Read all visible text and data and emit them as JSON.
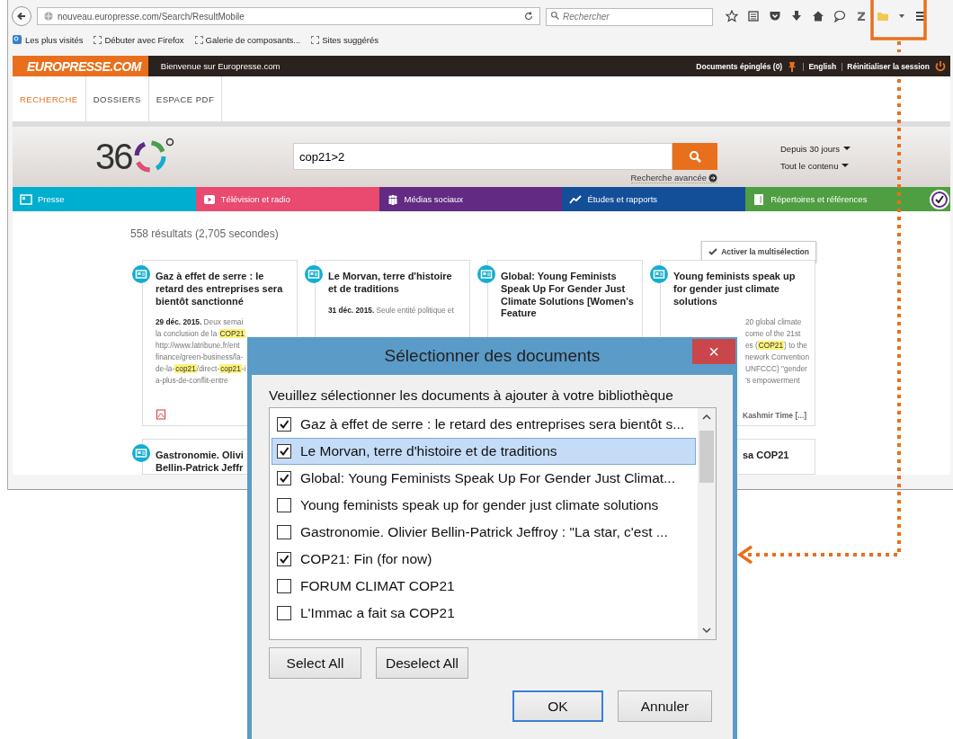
{
  "browser": {
    "url": "nouveau.europresse.com/Search/ResultMobile",
    "search_placeholder": "Rechercher",
    "bookmarks": [
      "Les plus visités",
      "Débuter avec Firefox",
      "Galerie de composants...",
      "Sites suggérés"
    ]
  },
  "site_header": {
    "logo": "EUROPRESSE.COM",
    "welcome": "Bienvenue sur Europresse.com",
    "pinned": "Documents épinglés (0)",
    "separators": [
      "|",
      "|"
    ],
    "language": "English",
    "reset": "Réinitialiser la session"
  },
  "nav_tabs": [
    {
      "label": "RECHERCHE",
      "selected": true
    },
    {
      "label": "DOSSIERS",
      "selected": false
    },
    {
      "label": "ESPACE PDF",
      "selected": false
    }
  ],
  "search": {
    "logo": "36",
    "query": "cop21>2",
    "advanced": "Recherche avancée",
    "filters": [
      "Depuis 30 jours",
      "Tout le contenu"
    ]
  },
  "categories": [
    {
      "label": "Presse",
      "color": "#00aed0"
    },
    {
      "label": "Télévision et radio",
      "color": "#e84a70"
    },
    {
      "label": "Médias sociaux",
      "color": "#622a82"
    },
    {
      "label": "Études et rapports",
      "color": "#134e98"
    },
    {
      "label": "Répertoires et références",
      "color": "#4f9e42"
    }
  ],
  "results": {
    "count": "558 résultats (2,705 secondes)",
    "multiselect": "Activer la multisélection"
  },
  "cards": [
    {
      "title": "Gaz à effet de serre : le retard des entreprises sera bientôt sanctionné",
      "lines": [
        [
          {
            "text": "**29 déc. 2015.** Deux semai",
            "highlighted": false
          }
        ],
        [
          {
            "text": "la conclusion de la ",
            "highlighted": false
          },
          {
            "text": "COP21",
            "highlighted": true
          }
        ],
        [
          {
            "text": "http://www.latribune.fr/ent",
            "highlighted": false
          }
        ],
        [
          {
            "text": "finance/green-business/la-",
            "highlighted": false
          }
        ],
        [
          {
            "text": "de-la-",
            "highlighted": false
          },
          {
            "text": "cop21",
            "highlighted": true
          },
          {
            "text": "/direct-",
            "highlighted": false
          },
          {
            "text": "cop21",
            "highlighted": true
          },
          {
            "text": "-i",
            "highlighted": false
          }
        ],
        [
          {
            "text": "a-plus-de-conflit-entre",
            "highlighted": false
          }
        ]
      ],
      "pdf": true
    },
    {
      "title": "Le Morvan, terre d'histoire et de traditions",
      "lines": [
        [
          {
            "text": "**31 déc. 2015.** Seule entité politique et",
            "highlighted": false
          }
        ]
      ],
      "pdf": false
    },
    {
      "title": "Global: Young Feminists Speak Up For Gender Just Climate Solutions [Women's Feature",
      "pdf": false
    },
    {
      "title": "Young feminists speak up for gender just climate solutions",
      "lines": [
        [
          {
            "text": "20 global climate",
            "highlighted": false
          }
        ],
        [
          {
            "text": "come of the 21st",
            "highlighted": false
          }
        ],
        [
          {
            "text": "es (",
            "highlighted": false
          },
          {
            "text": "COP21",
            "highlighted": true
          },
          {
            "text": ") to the",
            "highlighted": false
          }
        ],
        [
          {
            "text": "nework Convention",
            "highlighted": false
          }
        ],
        [
          {
            "text": "UNFCCC) \"gender",
            "highlighted": false
          }
        ],
        [
          {
            "text": "'s empowerment",
            "highlighted": false
          }
        ]
      ],
      "source": "Kashmir Time [...]",
      "pdf": false
    }
  ],
  "cards_row_2": [
    {
      "title_lines": [
        "Gastronomie. Olivi",
        "Bellin-Patrick Jeffr"
      ]
    },
    {
      "title_lines": [
        "sa COP21"
      ]
    }
  ],
  "dialog": {
    "title": "Sélectionner des documents",
    "close": "×",
    "prompt": "Veuillez sélectionner les documents à ajouter à votre bibliothèque",
    "items": [
      {
        "label": "Gaz à effet de serre : le retard des entreprises sera bientôt s...",
        "checked": true,
        "selected": false
      },
      {
        "label": "Le Morvan, terre d'histoire et de traditions",
        "checked": true,
        "selected": true
      },
      {
        "label": "Global: Young Feminists Speak Up For Gender Just Climat...",
        "checked": true,
        "selected": false
      },
      {
        "label": "Young feminists speak up for gender just climate solutions",
        "checked": false,
        "selected": false
      },
      {
        "label": "Gastronomie. Olivier Bellin-Patrick Jeffroy : \"La star, c'est ...",
        "checked": false,
        "selected": false
      },
      {
        "label": "COP21: Fin (for now)",
        "checked": true,
        "selected": false
      },
      {
        "label": "FORUM CLIMAT COP21",
        "checked": false,
        "selected": false
      },
      {
        "label": "L'Immac a fait sa COP21",
        "checked": false,
        "selected": false
      }
    ],
    "select_all": "Select All",
    "deselect_all": "Deselect All",
    "ok": "OK",
    "cancel": "Annuler"
  }
}
